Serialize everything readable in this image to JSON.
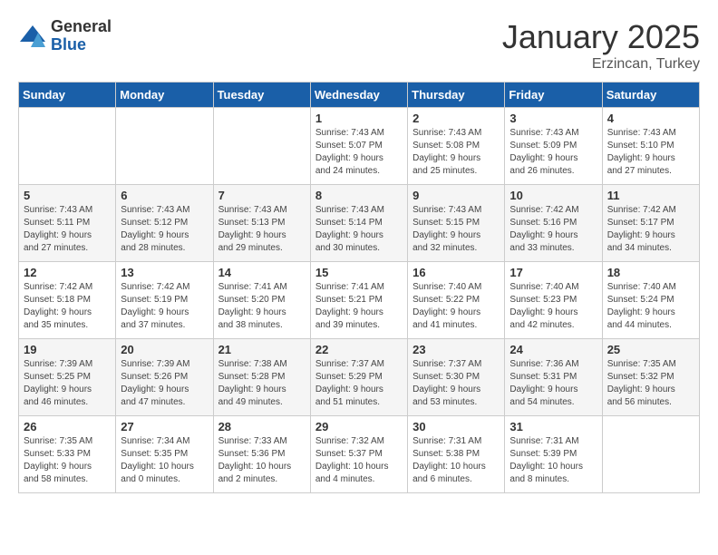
{
  "logo": {
    "general": "General",
    "blue": "Blue"
  },
  "title": "January 2025",
  "location": "Erzincan, Turkey",
  "days_header": [
    "Sunday",
    "Monday",
    "Tuesday",
    "Wednesday",
    "Thursday",
    "Friday",
    "Saturday"
  ],
  "weeks": [
    [
      {
        "num": "",
        "info": ""
      },
      {
        "num": "",
        "info": ""
      },
      {
        "num": "",
        "info": ""
      },
      {
        "num": "1",
        "info": "Sunrise: 7:43 AM\nSunset: 5:07 PM\nDaylight: 9 hours\nand 24 minutes."
      },
      {
        "num": "2",
        "info": "Sunrise: 7:43 AM\nSunset: 5:08 PM\nDaylight: 9 hours\nand 25 minutes."
      },
      {
        "num": "3",
        "info": "Sunrise: 7:43 AM\nSunset: 5:09 PM\nDaylight: 9 hours\nand 26 minutes."
      },
      {
        "num": "4",
        "info": "Sunrise: 7:43 AM\nSunset: 5:10 PM\nDaylight: 9 hours\nand 27 minutes."
      }
    ],
    [
      {
        "num": "5",
        "info": "Sunrise: 7:43 AM\nSunset: 5:11 PM\nDaylight: 9 hours\nand 27 minutes."
      },
      {
        "num": "6",
        "info": "Sunrise: 7:43 AM\nSunset: 5:12 PM\nDaylight: 9 hours\nand 28 minutes."
      },
      {
        "num": "7",
        "info": "Sunrise: 7:43 AM\nSunset: 5:13 PM\nDaylight: 9 hours\nand 29 minutes."
      },
      {
        "num": "8",
        "info": "Sunrise: 7:43 AM\nSunset: 5:14 PM\nDaylight: 9 hours\nand 30 minutes."
      },
      {
        "num": "9",
        "info": "Sunrise: 7:43 AM\nSunset: 5:15 PM\nDaylight: 9 hours\nand 32 minutes."
      },
      {
        "num": "10",
        "info": "Sunrise: 7:42 AM\nSunset: 5:16 PM\nDaylight: 9 hours\nand 33 minutes."
      },
      {
        "num": "11",
        "info": "Sunrise: 7:42 AM\nSunset: 5:17 PM\nDaylight: 9 hours\nand 34 minutes."
      }
    ],
    [
      {
        "num": "12",
        "info": "Sunrise: 7:42 AM\nSunset: 5:18 PM\nDaylight: 9 hours\nand 35 minutes."
      },
      {
        "num": "13",
        "info": "Sunrise: 7:42 AM\nSunset: 5:19 PM\nDaylight: 9 hours\nand 37 minutes."
      },
      {
        "num": "14",
        "info": "Sunrise: 7:41 AM\nSunset: 5:20 PM\nDaylight: 9 hours\nand 38 minutes."
      },
      {
        "num": "15",
        "info": "Sunrise: 7:41 AM\nSunset: 5:21 PM\nDaylight: 9 hours\nand 39 minutes."
      },
      {
        "num": "16",
        "info": "Sunrise: 7:40 AM\nSunset: 5:22 PM\nDaylight: 9 hours\nand 41 minutes."
      },
      {
        "num": "17",
        "info": "Sunrise: 7:40 AM\nSunset: 5:23 PM\nDaylight: 9 hours\nand 42 minutes."
      },
      {
        "num": "18",
        "info": "Sunrise: 7:40 AM\nSunset: 5:24 PM\nDaylight: 9 hours\nand 44 minutes."
      }
    ],
    [
      {
        "num": "19",
        "info": "Sunrise: 7:39 AM\nSunset: 5:25 PM\nDaylight: 9 hours\nand 46 minutes."
      },
      {
        "num": "20",
        "info": "Sunrise: 7:39 AM\nSunset: 5:26 PM\nDaylight: 9 hours\nand 47 minutes."
      },
      {
        "num": "21",
        "info": "Sunrise: 7:38 AM\nSunset: 5:28 PM\nDaylight: 9 hours\nand 49 minutes."
      },
      {
        "num": "22",
        "info": "Sunrise: 7:37 AM\nSunset: 5:29 PM\nDaylight: 9 hours\nand 51 minutes."
      },
      {
        "num": "23",
        "info": "Sunrise: 7:37 AM\nSunset: 5:30 PM\nDaylight: 9 hours\nand 53 minutes."
      },
      {
        "num": "24",
        "info": "Sunrise: 7:36 AM\nSunset: 5:31 PM\nDaylight: 9 hours\nand 54 minutes."
      },
      {
        "num": "25",
        "info": "Sunrise: 7:35 AM\nSunset: 5:32 PM\nDaylight: 9 hours\nand 56 minutes."
      }
    ],
    [
      {
        "num": "26",
        "info": "Sunrise: 7:35 AM\nSunset: 5:33 PM\nDaylight: 9 hours\nand 58 minutes."
      },
      {
        "num": "27",
        "info": "Sunrise: 7:34 AM\nSunset: 5:35 PM\nDaylight: 10 hours\nand 0 minutes."
      },
      {
        "num": "28",
        "info": "Sunrise: 7:33 AM\nSunset: 5:36 PM\nDaylight: 10 hours\nand 2 minutes."
      },
      {
        "num": "29",
        "info": "Sunrise: 7:32 AM\nSunset: 5:37 PM\nDaylight: 10 hours\nand 4 minutes."
      },
      {
        "num": "30",
        "info": "Sunrise: 7:31 AM\nSunset: 5:38 PM\nDaylight: 10 hours\nand 6 minutes."
      },
      {
        "num": "31",
        "info": "Sunrise: 7:31 AM\nSunset: 5:39 PM\nDaylight: 10 hours\nand 8 minutes."
      },
      {
        "num": "",
        "info": ""
      }
    ]
  ]
}
